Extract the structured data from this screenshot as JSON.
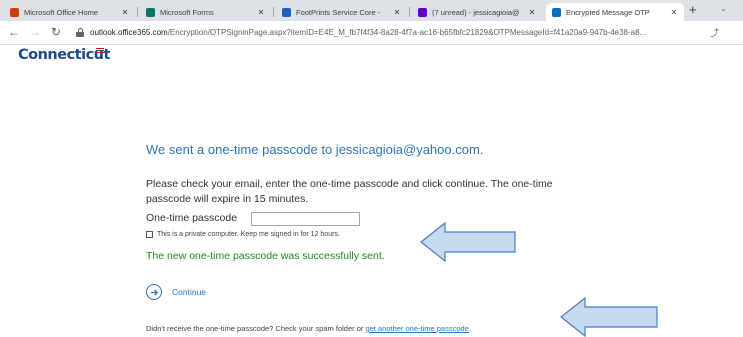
{
  "browser": {
    "tabs": [
      {
        "title": "Microsoft Office Home",
        "favicon_color": "#d83b01",
        "active": false
      },
      {
        "title": "Microsoft Forms",
        "favicon_color": "#077568",
        "active": false
      },
      {
        "title": "FootPrints Service Core -",
        "favicon_color": "#1d5fbf",
        "active": false
      },
      {
        "title": "(7 unread) - jessicagioia@",
        "favicon_color": "#6001d2",
        "active": false
      },
      {
        "title": "Encrypted Message OTP",
        "favicon_color": "#0f6cbd",
        "active": true
      }
    ],
    "address": {
      "host": "outlook.office365.com",
      "path": "/Encryption/OTPSigninPage.aspx?itemID=E4E_M_fb7f4f34-8a28-4f7a-ac16-b65fbfc21829&OTPMessageId=f41a20a9-947b-4e38-a8..."
    }
  },
  "brand": {
    "name": "Connecticut",
    "color": "#1f4a8a",
    "accent": "#c8102e"
  },
  "page": {
    "heading": "We sent a one-time passcode to jessicagioia@yahoo.com.",
    "instructions": "Please check your email, enter the one-time passcode and click continue. The one-time passcode will expire in 15 minutes.",
    "otp_label": "One-time passcode",
    "otp_value": "",
    "remember_label": "This is a private computer. Keep me signed in for 12 hours.",
    "remember_checked": false,
    "success_message": "The new one-time passcode was successfully sent.",
    "continue_label": "Continue",
    "resend_prefix": "Didn't receive the one-time passcode? Check your spam folder or ",
    "resend_link": "get another one-time passcode",
    "resend_suffix": "."
  },
  "colors": {
    "accent_blue": "#2e75b6",
    "success_green": "#1e8a1e",
    "annotation_arrow_fill": "#c5d9f1",
    "annotation_arrow_stroke": "#4a7ebb"
  }
}
